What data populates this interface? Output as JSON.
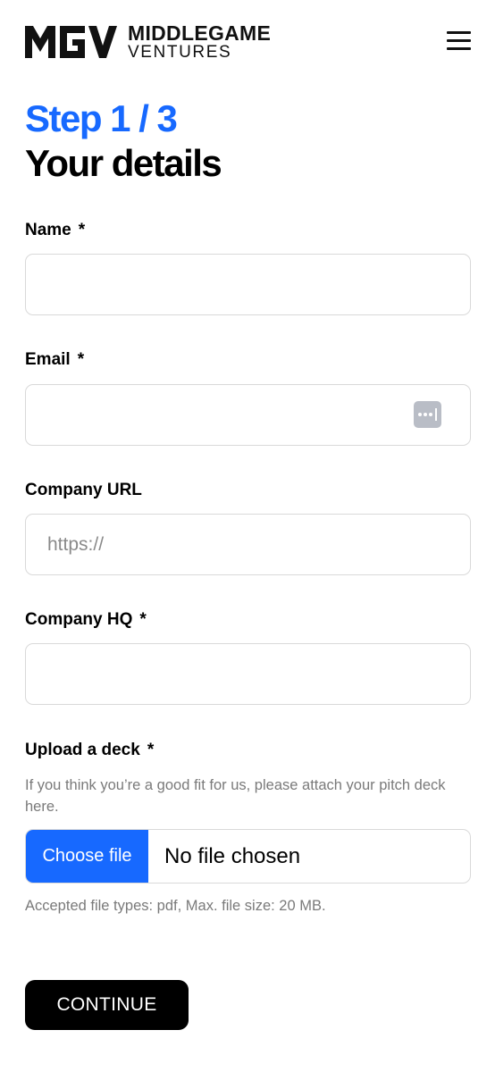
{
  "header": {
    "logo": {
      "mark_icon": "mgv-logo-icon",
      "mark_text": "MGV",
      "line1": "MIDDLEGAME",
      "line2": "VENTURES"
    },
    "menu_icon": "hamburger-menu-icon"
  },
  "step": "Step 1 / 3",
  "title": "Your details",
  "form": {
    "name": {
      "label": "Name",
      "required_mark": "*",
      "value": "",
      "placeholder": ""
    },
    "email": {
      "label": "Email",
      "required_mark": "*",
      "value": "",
      "placeholder": "",
      "autofill_icon": "password-autofill-icon"
    },
    "company_url": {
      "label": "Company URL",
      "value": "",
      "placeholder": "https://"
    },
    "company_hq": {
      "label": "Company HQ",
      "required_mark": "*",
      "value": "",
      "placeholder": ""
    },
    "deck": {
      "label": "Upload a deck",
      "required_mark": "*",
      "help": "If you think you’re a good fit for us, please attach your pitch deck here.",
      "button_label": "Choose file",
      "status": "No file chosen",
      "accepted": "Accepted file types: pdf, Max. file size: 20 MB."
    }
  },
  "continue_label": "CONTINUE",
  "colors": {
    "accent": "#1769ff",
    "text": "#000000",
    "muted": "#7a7a7a",
    "border": "#d9d9d9",
    "button_bg": "#000000"
  }
}
